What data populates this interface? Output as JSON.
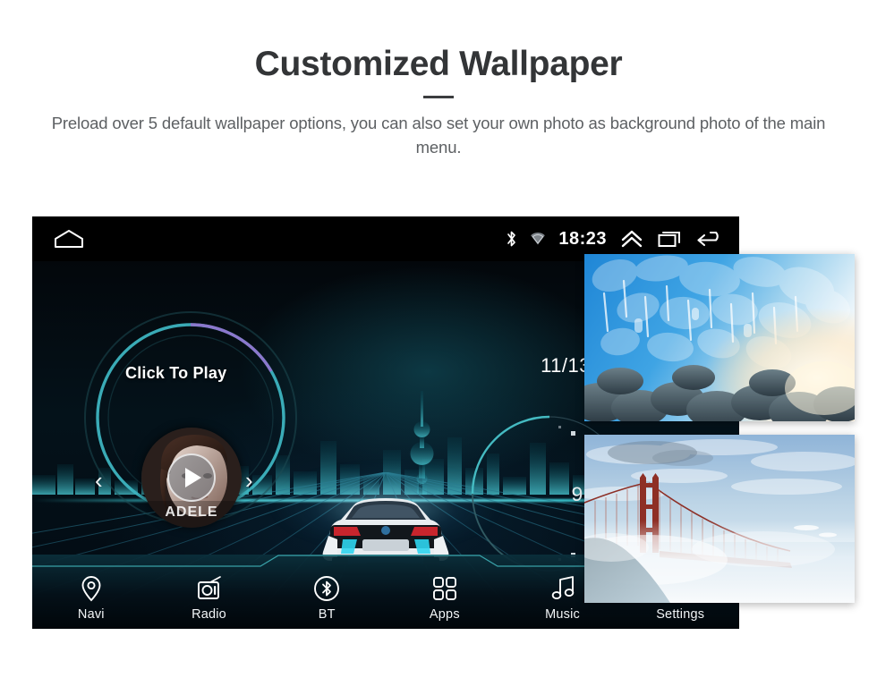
{
  "header": {
    "title": "Customized Wallpaper",
    "subtitle": "Preload over 5 default wallpaper options, you can also set your own photo as background photo of the main menu."
  },
  "device": {
    "statusbar": {
      "home_icon": "home-icon",
      "bluetooth_icon": "bluetooth-icon",
      "wifi_icon": "wifi-icon",
      "time": "18:23",
      "expand_icon": "double-chevron-up-icon",
      "recents_icon": "recent-apps-icon",
      "back_icon": "back-arrow-icon"
    },
    "screen": {
      "music_widget": {
        "title": "Click To Play",
        "album_artist": "ADELE",
        "play_icon": "play-icon",
        "prev_icon": "chevron-left-icon",
        "next_icon": "chevron-right-icon"
      },
      "date": "11/13",
      "gauge_label": "9",
      "background_scene": "car-city-grid-wallpaper"
    },
    "navbar": {
      "items": [
        {
          "label": "Navi",
          "icon": "map-pin-icon"
        },
        {
          "label": "Radio",
          "icon": "radio-icon"
        },
        {
          "label": "BT",
          "icon": "bluetooth-circle-icon"
        },
        {
          "label": "Apps",
          "icon": "grid-apps-icon"
        },
        {
          "label": "Music",
          "icon": "music-note-icon"
        },
        {
          "label": "Settings",
          "icon": "gear-icon"
        }
      ]
    }
  },
  "wallpaper_previews": [
    {
      "name": "ice-cave-wallpaper",
      "caption": "Ice cave"
    },
    {
      "name": "golden-gate-wallpaper",
      "caption": "Golden Gate Bridge in fog"
    }
  ],
  "colors": {
    "title": "#333537",
    "subtitle": "#5d6063",
    "accent_teal": "#3fd6e0",
    "screen_bg": "#020a12",
    "page_bg": "#ffffff"
  }
}
